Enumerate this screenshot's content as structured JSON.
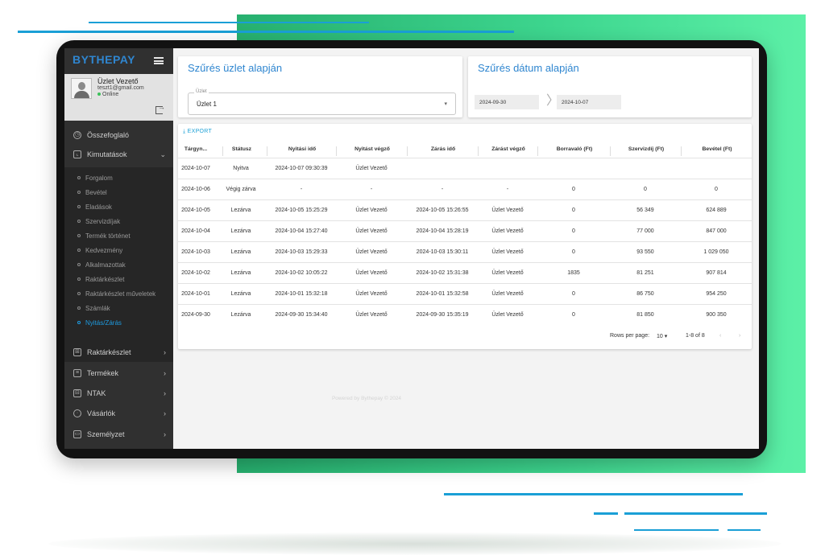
{
  "app": {
    "brand": "BYTHEPAY"
  },
  "colors": {
    "accent": "#2f86d0",
    "link": "#1ea1d6",
    "online": "#3cc15a",
    "sidebar_bg": "#303030",
    "green_bg": "#3dd58e"
  },
  "profile": {
    "name": "Üzlet Vezető",
    "email": "teszt1@gmail.com",
    "status": "Online"
  },
  "sidebar": {
    "items": [
      {
        "label": "Összefoglaló",
        "icon": "clock-icon"
      },
      {
        "label": "Kimutatások",
        "icon": "chart-icon",
        "expanded": true
      }
    ],
    "sub_items": [
      "Forgalom",
      "Bevétel",
      "Eladások",
      "Szervizdíjak",
      "Termék történet",
      "Kedvezmény",
      "Alkalmazottak",
      "Raktárkészlet",
      "Raktárkészlet műveletek",
      "Számlák",
      "Nyitás/Zárás"
    ],
    "active_sub": "Nyitás/Zárás",
    "bottom_items": [
      {
        "label": "Raktárkészlet",
        "icon": "grid-icon"
      },
      {
        "label": "Termékek",
        "icon": "box-icon"
      },
      {
        "label": "NTAK",
        "icon": "inbox-icon"
      },
      {
        "label": "Vásárlók",
        "icon": "user-icon"
      },
      {
        "label": "Személyzet",
        "icon": "briefcase-icon"
      }
    ]
  },
  "filter_shop": {
    "title": "Szűrés üzlet alapján",
    "select_label": "Üzlet",
    "select_value": "Üzlet 1"
  },
  "filter_date": {
    "title": "Szűrés dátum alapján",
    "from": "2024-09-30",
    "to": "2024-10-07"
  },
  "table": {
    "export_label": "EXPORT",
    "headers": [
      "Tárgyn...",
      "Státusz",
      "Nyitási idő",
      "Nyitást végző",
      "Zárás idő",
      "Zárást végző",
      "Borravaló (Ft)",
      "Szervizdíj (Ft)",
      "Bevétel (Ft)"
    ],
    "rows": [
      [
        "2024-10-07",
        "Nyitva",
        "2024-10-07 09:30:39",
        "Üzlet Vezető",
        "",
        "",
        "",
        "",
        ""
      ],
      [
        "2024-10-06",
        "Végig zárva",
        "-",
        "-",
        "-",
        "-",
        "0",
        "0",
        "0"
      ],
      [
        "2024-10-05",
        "Lezárva",
        "2024-10-05 15:25:29",
        "Üzlet Vezető",
        "2024-10-05 15:26:55",
        "Üzlet Vezető",
        "0",
        "56 349",
        "624 889"
      ],
      [
        "2024-10-04",
        "Lezárva",
        "2024-10-04 15:27:40",
        "Üzlet Vezető",
        "2024-10-04 15:28:19",
        "Üzlet Vezető",
        "0",
        "77 000",
        "847 000"
      ],
      [
        "2024-10-03",
        "Lezárva",
        "2024-10-03 15:29:33",
        "Üzlet Vezető",
        "2024-10-03 15:30:11",
        "Üzlet Vezető",
        "0",
        "93 550",
        "1 029 050"
      ],
      [
        "2024-10-02",
        "Lezárva",
        "2024-10-02 10:05:22",
        "Üzlet Vezető",
        "2024-10-02 15:31:38",
        "Üzlet Vezető",
        "1835",
        "81 251",
        "907 814"
      ],
      [
        "2024-10-01",
        "Lezárva",
        "2024-10-01 15:32:18",
        "Üzlet Vezető",
        "2024-10-01 15:32:58",
        "Üzlet Vezető",
        "0",
        "86 750",
        "954 250"
      ],
      [
        "2024-09-30",
        "Lezárva",
        "2024-09-30 15:34:40",
        "Üzlet Vezető",
        "2024-09-30 15:35:19",
        "Üzlet Vezető",
        "0",
        "81 850",
        "900 350"
      ]
    ],
    "rows_per_page_label": "Rows per page:",
    "rows_per_page": "10",
    "range": "1-8 of 8"
  },
  "footer": {
    "text": "Powered by Bythepay © 2024"
  }
}
